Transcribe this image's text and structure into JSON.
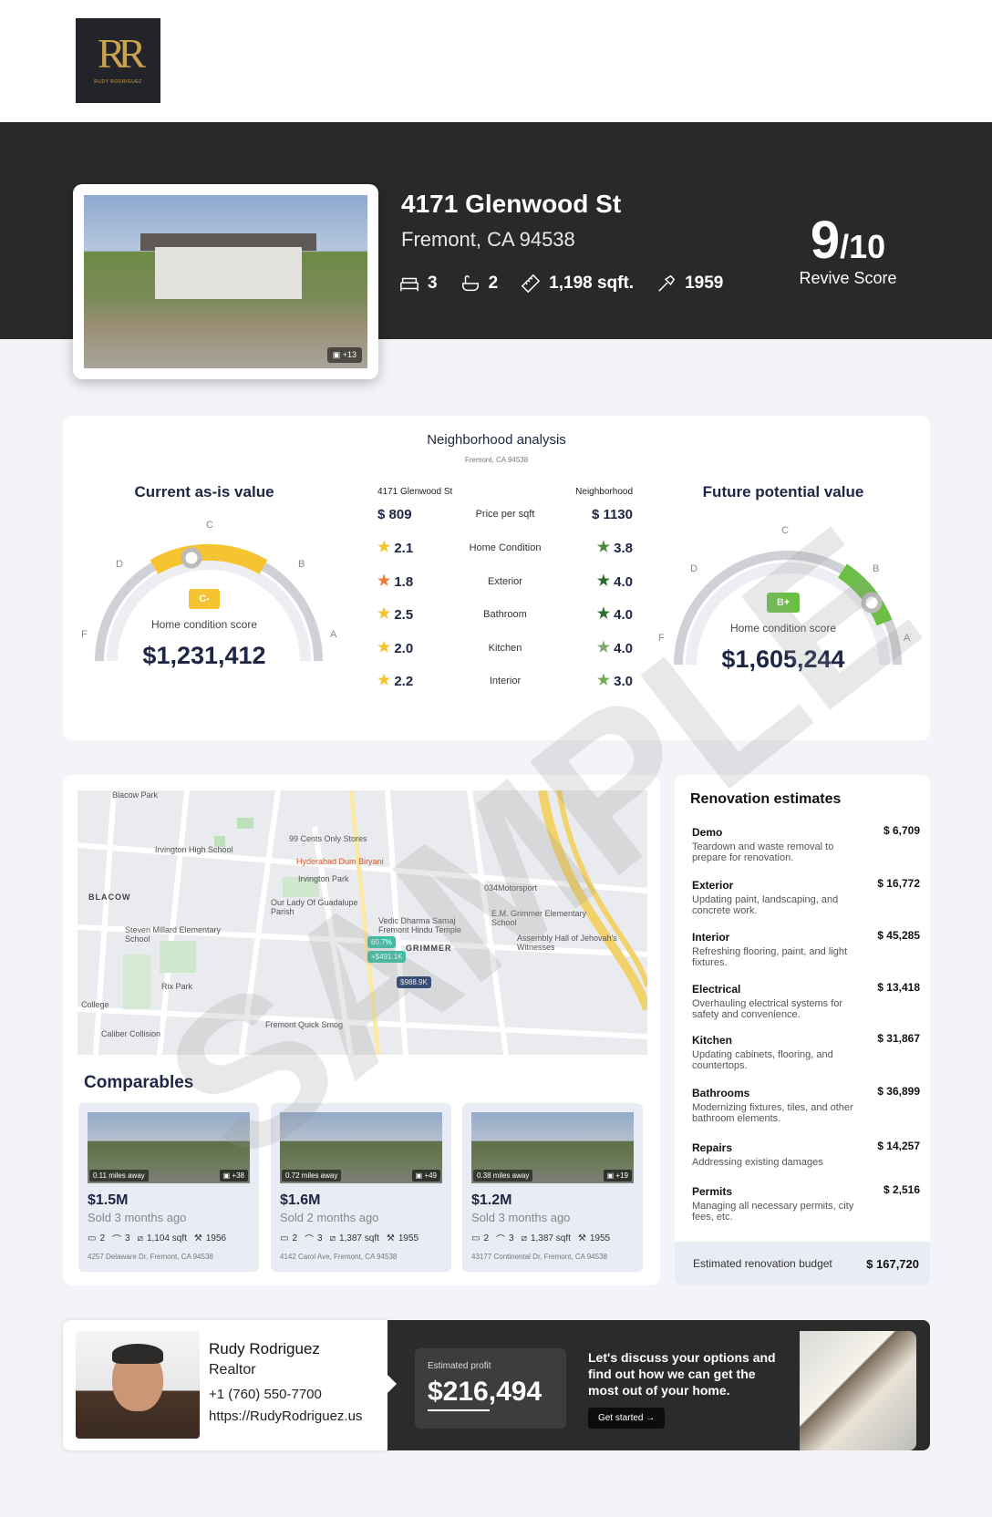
{
  "brand": {
    "logo_letters": "RR",
    "logo_sub": "RUDY RODRIGUEZ"
  },
  "property": {
    "street": "4171 Glenwood St",
    "city": "Fremont, CA 94538",
    "beds": "3",
    "baths": "2",
    "sqft": "1,198 sqft.",
    "year": "1959",
    "photo_count": "+13"
  },
  "score": {
    "value": "9",
    "denominator": "/10",
    "label": "Revive Score"
  },
  "neighborhood": {
    "title": "Neighborhood analysis",
    "subtitle": "Fremont, CA 94538",
    "col_left": "4171 Glenwood St",
    "col_right": "Neighborhood",
    "rows": [
      {
        "left": "$ 809",
        "metric": "Price per sqft",
        "right": "$ 1130"
      },
      {
        "left": "2.1",
        "metric": "Home Condition",
        "right": "3.8"
      },
      {
        "left": "1.8",
        "metric": "Exterior",
        "right": "4.0"
      },
      {
        "left": "2.5",
        "metric": "Bathroom",
        "right": "4.0"
      },
      {
        "left": "2.0",
        "metric": "Kitchen",
        "right": "4.0"
      },
      {
        "left": "2.2",
        "metric": "Interior",
        "right": "3.0"
      }
    ],
    "star_colors_left": [
      "#f4c430",
      "#f07b3f",
      "#f4c430",
      "#f4c430",
      "#f4c430"
    ],
    "star_colors_right": [
      "#4f8a3c",
      "#2e6b2e",
      "#2e6b2e",
      "#7fa86a",
      "#6fae52"
    ]
  },
  "current": {
    "title": "Current as-is value",
    "grade": "C-",
    "caption": "Home condition score",
    "value": "$1,231,412",
    "accent": "#f6c431"
  },
  "future": {
    "title": "Future potential value",
    "grade": "B+",
    "caption": "Home condition score",
    "value": "$1,605,244",
    "accent": "#6cbf45"
  },
  "grades": {
    "f": "F",
    "d": "D",
    "c": "C",
    "b": "B",
    "a": "A"
  },
  "map": {
    "labels": [
      "Blacow Park",
      "Irvington High School",
      "99 Cents Only Stores",
      "Hyderabad Dum Biryani",
      "Irvington Park",
      "Our Lady Of Guadalupe Parish",
      "BLACOW",
      "Steven Millard Elementary School",
      "034Motorsport",
      "E.M. Grimmer Elementary School",
      "Vedic Dharma Samaj Fremont Hindu Temple",
      "Assembly Hall of Jehovah's Witnesses",
      "GRIMMER",
      "Rix Park",
      "College",
      "Caliber Collision",
      "Fremont Quick Smog"
    ],
    "pins": [
      "60.7%",
      "+$491.1K",
      "$988.9K"
    ]
  },
  "comparables": {
    "title": "Comparables",
    "items": [
      {
        "distance": "0.11 miles away",
        "photos": "+38",
        "price": "$1.5M",
        "sold": "Sold 3 months ago",
        "beds": "2",
        "baths": "3",
        "sqft": "1,104 sqft",
        "year": "1956",
        "address": "4257 Delaware Dr, Fremont, CA 94538"
      },
      {
        "distance": "0.72 miles away",
        "photos": "+49",
        "price": "$1.6M",
        "sold": "Sold 2 months ago",
        "beds": "2",
        "baths": "3",
        "sqft": "1,387 sqft",
        "year": "1955",
        "address": "4142 Carol Ave, Fremont, CA 94538"
      },
      {
        "distance": "0.38 miles away",
        "photos": "+19",
        "price": "$1.2M",
        "sold": "Sold 3 months ago",
        "beds": "2",
        "baths": "3",
        "sqft": "1,387 sqft",
        "year": "1955",
        "address": "43177 Continental Dr, Fremont, CA 94538"
      }
    ]
  },
  "renovation": {
    "title": "Renovation estimates",
    "items": [
      {
        "name": "Demo",
        "cost": "$ 6,709",
        "desc": "Teardown and waste removal to prepare for renovation."
      },
      {
        "name": "Exterior",
        "cost": "$ 16,772",
        "desc": "Updating paint, landscaping, and concrete work."
      },
      {
        "name": "Interior",
        "cost": "$ 45,285",
        "desc": "Refreshing flooring, paint, and light fixtures."
      },
      {
        "name": "Electrical",
        "cost": "$ 13,418",
        "desc": "Overhauling electrical systems for safety and convenience."
      },
      {
        "name": "Kitchen",
        "cost": "$ 31,867",
        "desc": "Updating cabinets, flooring, and countertops."
      },
      {
        "name": "Bathrooms",
        "cost": "$ 36,899",
        "desc": "Modernizing fixtures, tiles, and other bathroom elements."
      },
      {
        "name": "Repairs",
        "cost": "$ 14,257",
        "desc": "Addressing existing damages"
      },
      {
        "name": "Permits",
        "cost": "$ 2,516",
        "desc": "Managing all necessary permits, city fees, etc."
      }
    ],
    "budget_label": "Estimated renovation budget",
    "budget_value": "$ 167,720"
  },
  "agent": {
    "name": "Rudy Rodriguez",
    "role": "Realtor",
    "phone": "+1 (760) 550-7700",
    "website": "https://RudyRodriguez.us"
  },
  "cta": {
    "profit_label": "Estimated profit",
    "profit_value": "$216,494",
    "message": "Let's discuss your options and find out how we can get the most out of your home.",
    "button": "Get started"
  },
  "watermark": "SAMPLE"
}
